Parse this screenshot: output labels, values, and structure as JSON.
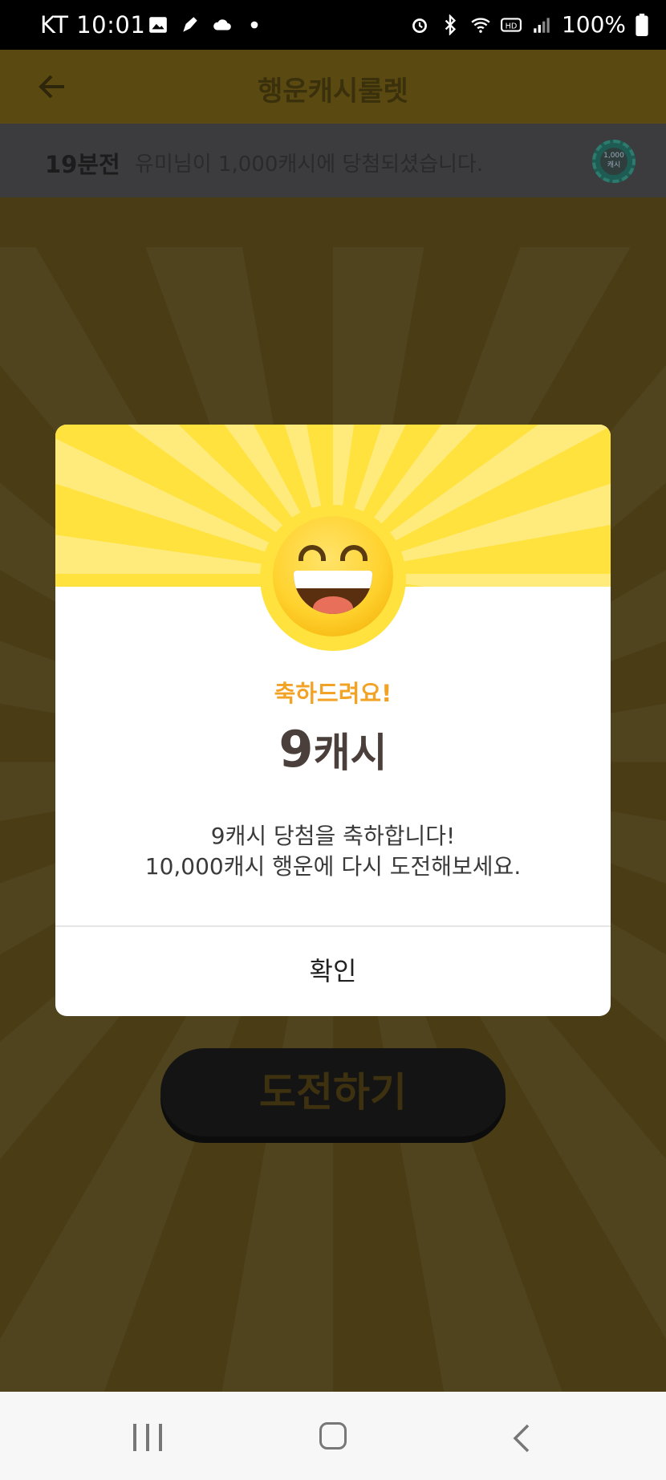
{
  "status_bar": {
    "carrier": "KT",
    "time": "10:01",
    "battery": "100%",
    "icons": [
      "gallery-icon",
      "pen-icon",
      "cloud-icon",
      "dot-icon",
      "alarm-icon",
      "bluetooth-icon",
      "wifi-icon",
      "hd-icon",
      "signal-icon",
      "battery-icon"
    ]
  },
  "header": {
    "title": "행운캐시룰렛",
    "back_icon": "arrow-left-icon"
  },
  "ticker": {
    "time": "19분전",
    "message": "유미님이 1,000캐시에 당첨되셨습니다.",
    "chip_label": "1,000",
    "chip_sub": "캐시"
  },
  "modal": {
    "title": "축하드려요!",
    "prize_amount": "9",
    "prize_unit": "캐시",
    "line1": "9캐시 당첨을 축하합니다!",
    "line2": "10,000캐시 행운에 다시 도전해보세요.",
    "confirm_label": "확인"
  },
  "challenge_button": {
    "label": "도전하기"
  },
  "colors": {
    "accent_yellow": "#ffe23d",
    "congrats_orange": "#f2a326",
    "overlay_bg": "#4a3d16"
  }
}
